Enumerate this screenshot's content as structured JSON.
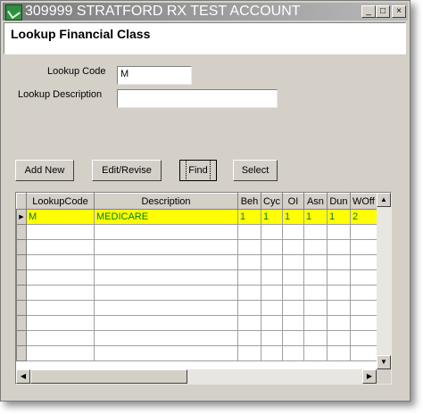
{
  "window": {
    "title": "309999 STRATFORD RX TEST ACCOUNT",
    "minimize_label": "_",
    "maximize_label": "□",
    "close_label": "×"
  },
  "page_title": "Lookup Financial Class",
  "form": {
    "code_label": "Lookup Code",
    "code_value": "M",
    "description_label": "Lookup Description",
    "description_value": ""
  },
  "buttons": {
    "add_new": "Add New",
    "edit_revise": "Edit/Revise",
    "find": "Find",
    "select": "Select"
  },
  "grid": {
    "columns": [
      "LookupCode",
      "Description",
      "Beh",
      "Cyc",
      "OI",
      "Asn",
      "Dun",
      "WOff"
    ],
    "rows": [
      [
        "M",
        "MEDICARE",
        "1",
        "1",
        "1",
        "1",
        "1",
        "2"
      ]
    ],
    "selected_row_marker": "▶",
    "scroll_up": "▲",
    "scroll_down": "▼",
    "scroll_left": "◀",
    "scroll_right": "▶"
  },
  "colors": {
    "selected_row_bg": "#ffff00",
    "selected_row_text": "#008000",
    "title_bar": "#7b7b7b"
  }
}
